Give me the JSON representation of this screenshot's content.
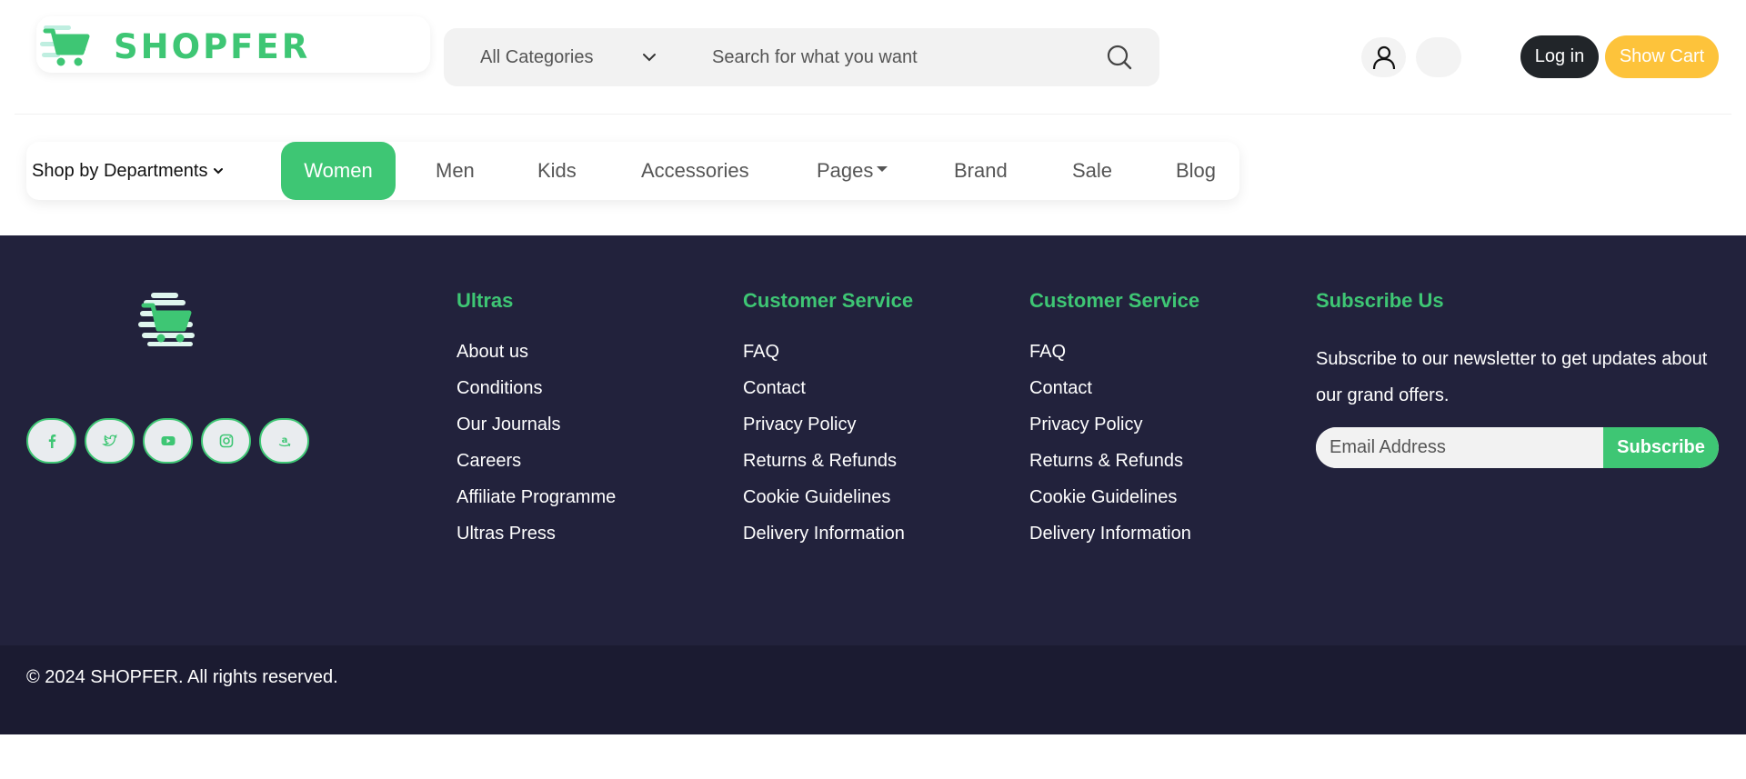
{
  "brand": {
    "name": "SHOPFER",
    "logo_icon": "shopping-cart-icon",
    "color": "#3ec674"
  },
  "search": {
    "category_selected": "All Categories",
    "placeholder": "Search for what you want",
    "icon": "search-icon"
  },
  "header_actions": {
    "user_icon": "user-icon",
    "login_label": "Log in",
    "cart_label": "Show Cart",
    "login_color": "#212529",
    "cart_color": "#fdc33b"
  },
  "nav": {
    "departments_label": "Shop by Departments",
    "items": [
      {
        "label": "Women",
        "active": true
      },
      {
        "label": "Men"
      },
      {
        "label": "Kids"
      },
      {
        "label": "Accessories"
      },
      {
        "label": "Pages",
        "dropdown": true
      },
      {
        "label": "Brand"
      },
      {
        "label": "Sale"
      },
      {
        "label": "Blog"
      }
    ]
  },
  "footer": {
    "background": "#22223c",
    "socials": [
      "facebook-icon",
      "twitter-icon",
      "youtube-icon",
      "instagram-icon",
      "amazon-icon"
    ],
    "columns": [
      {
        "title": "Ultras",
        "links": [
          "About us",
          "Conditions",
          "Our Journals",
          "Careers",
          "Affiliate Programme",
          "Ultras Press"
        ]
      },
      {
        "title": "Customer Service",
        "links": [
          "FAQ",
          "Contact",
          "Privacy Policy",
          "Returns & Refunds",
          "Cookie Guidelines",
          "Delivery Information"
        ]
      },
      {
        "title": "Customer Service",
        "links": [
          "FAQ",
          "Contact",
          "Privacy Policy",
          "Returns & Refunds",
          "Cookie Guidelines",
          "Delivery Information"
        ]
      }
    ],
    "subscribe": {
      "title": "Subscribe Us",
      "text": "Subscribe to our newsletter to get updates about our grand offers.",
      "email_placeholder": "Email Address",
      "button_label": "Subscribe"
    },
    "copyright": "© 2024 SHOPFER. All rights reserved."
  }
}
